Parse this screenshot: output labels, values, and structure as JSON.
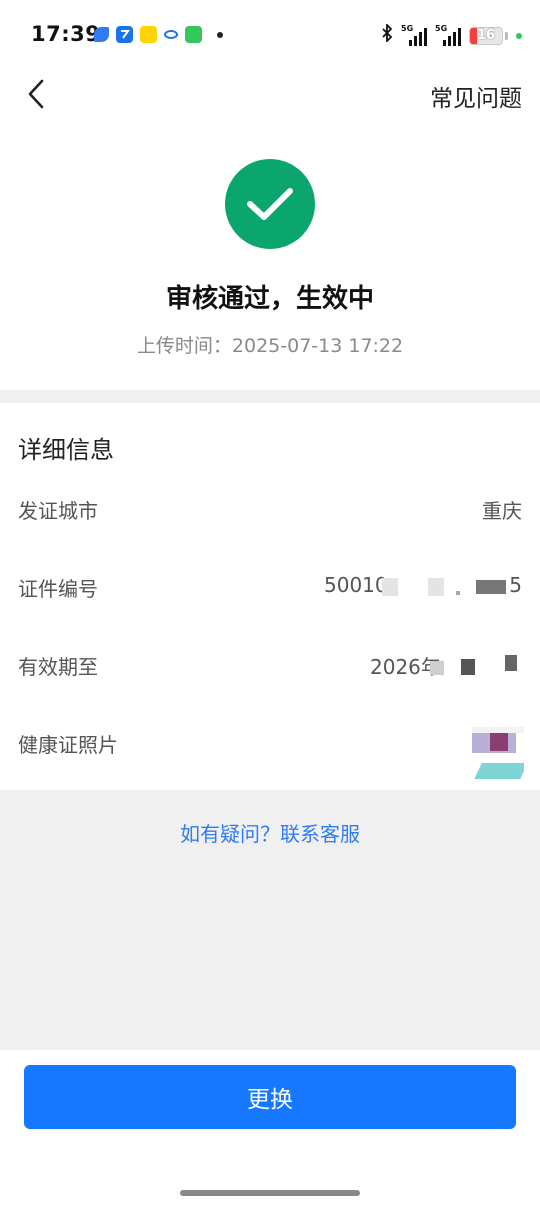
{
  "status_bar": {
    "time": "17:39",
    "network_1": "5G",
    "network_2": "5G",
    "battery": "16",
    "icons": [
      "feather-app-icon",
      "fly-app-icon",
      "yellow-app-icon",
      "link-app-icon",
      "chat-app-icon",
      "bluetooth-icon"
    ]
  },
  "header": {
    "back_icon": "chevron-left-icon",
    "faq": "常见问题"
  },
  "result": {
    "icon": "check-circle-icon",
    "title": "审核通过，生效中",
    "upload_time": "上传时间：2025-07-13 17:22"
  },
  "detail": {
    "title": "详细信息",
    "rows": [
      {
        "label": "发证城市",
        "value": "重庆"
      },
      {
        "label": "证件编号",
        "value_visible_start": "50010",
        "value_visible_end": "5"
      },
      {
        "label": "有效期至",
        "value_visible_start": "2026年"
      },
      {
        "label": "健康证照片"
      }
    ]
  },
  "contact": "如有疑问？联系客服",
  "action": {
    "replace": "更换"
  },
  "colors": {
    "success": "#0aa66e",
    "primary": "#1677ff",
    "link": "#2f7cf6",
    "background": "#f0f0f0"
  }
}
